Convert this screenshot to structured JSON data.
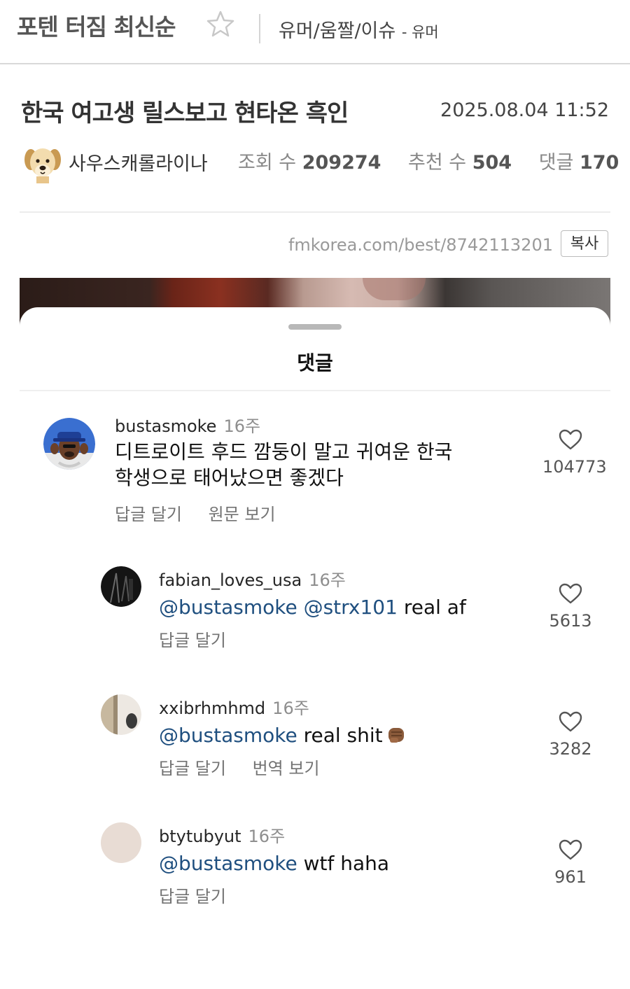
{
  "board": {
    "name": "포텐 터짐 최신순",
    "breadcrumb": "유머/움짤/이슈",
    "breadcrumb_sub": "- 유머"
  },
  "post": {
    "title": "한국 여고생 릴스보고 현타온 흑인",
    "date": "2025.08.04 11:52",
    "author": "사우스캐롤라이나",
    "views_label": "조회 수",
    "views": "209274",
    "recommend_label": "추천 수",
    "recommend": "504",
    "comments_label": "댓글",
    "comments": "170",
    "url": "fmkorea.com/best/8742113201",
    "copy_label": "복사"
  },
  "embed": {
    "sheet_title": "댓글",
    "comments": [
      {
        "username": "bustasmoke",
        "time": "16주",
        "text_line1": "디트로이트 후드 깜둥이 말고 귀여운 한국",
        "text_line2": "학생으로 태어났으면 좋겠다",
        "action_reply": "답글 달기",
        "action_extra": "원문 보기",
        "likes": "104773"
      },
      {
        "username": "fabian_loves_usa",
        "time": "16주",
        "mention": "@bustasmoke @strx101",
        "text": " real af",
        "action_reply": "답글 달기",
        "likes": "5613"
      },
      {
        "username": "xxibrhmhmd",
        "time": "16주",
        "mention": "@bustasmoke",
        "text": " real shit",
        "action_reply": "답글 달기",
        "action_extra": "번역 보기",
        "likes": "3282"
      },
      {
        "username": "btytubyut",
        "time": "16주",
        "mention": "@bustasmoke",
        "text": " wtf haha",
        "action_reply": "답글 달기",
        "likes": "961"
      }
    ]
  },
  "icons": [
    "star-icon",
    "dog-avatar-icon",
    "heart-icon",
    "fist-emoji-icon"
  ]
}
